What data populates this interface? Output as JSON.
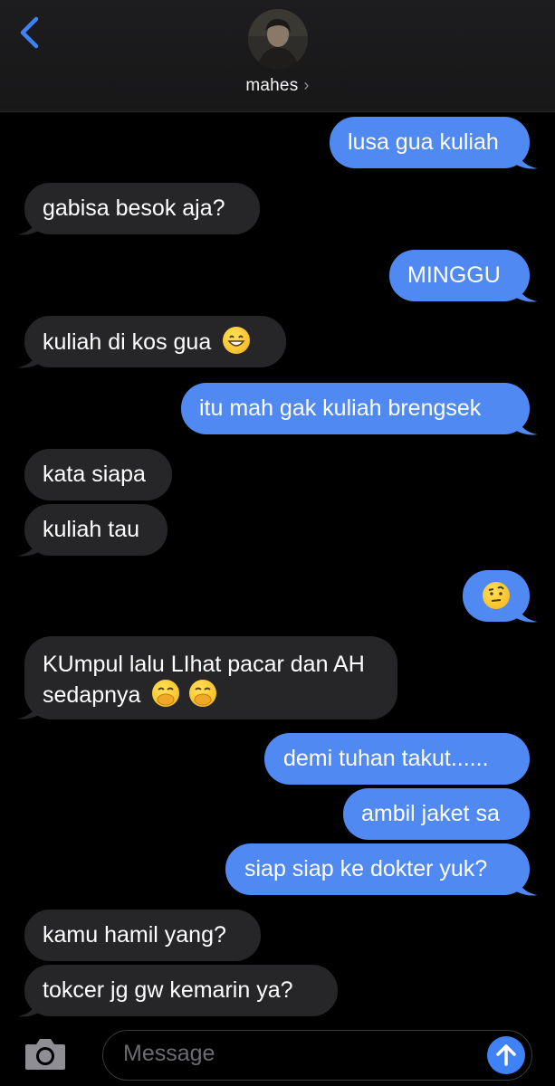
{
  "header": {
    "contact_name": "mahes",
    "chevron": "›",
    "back_icon": "chevron-left-icon",
    "accent": "#3f82f6"
  },
  "messages": [
    {
      "side": "out",
      "text": "lusa gua kuliah"
    },
    {
      "side": "in",
      "text": "gabisa besok aja?"
    },
    {
      "side": "out",
      "text": "MINGGU"
    },
    {
      "side": "in",
      "text": "kuliah di kos gua",
      "emoji": "grinning-face"
    },
    {
      "side": "out",
      "text": "itu mah gak kuliah brengsek"
    },
    {
      "side": "in",
      "text": "kata siapa"
    },
    {
      "side": "in",
      "text": "kuliah tau"
    },
    {
      "side": "out",
      "emoji": "face-with-raised-eyebrow"
    },
    {
      "side": "in",
      "text_line1": "KUmpul lalu LIhat pacar dan AH",
      "text_line2": "sedapnya",
      "emoji": "face-with-hand-over-mouth"
    },
    {
      "side": "out",
      "text": "demi tuhan takut......"
    },
    {
      "side": "out",
      "text": "ambil jaket sa"
    },
    {
      "side": "out",
      "text": "siap siap ke dokter yuk?"
    },
    {
      "side": "in",
      "text": "kamu hamil yang?"
    },
    {
      "side": "in",
      "text": "tokcer jg gw kemarin ya?"
    }
  ],
  "composer": {
    "placeholder": "Message",
    "camera_icon": "camera-icon",
    "send_icon": "arrow-up-icon"
  },
  "colors": {
    "incoming_bubble": "#262628",
    "outgoing_bubble": "#5189f2",
    "background": "#000000"
  }
}
